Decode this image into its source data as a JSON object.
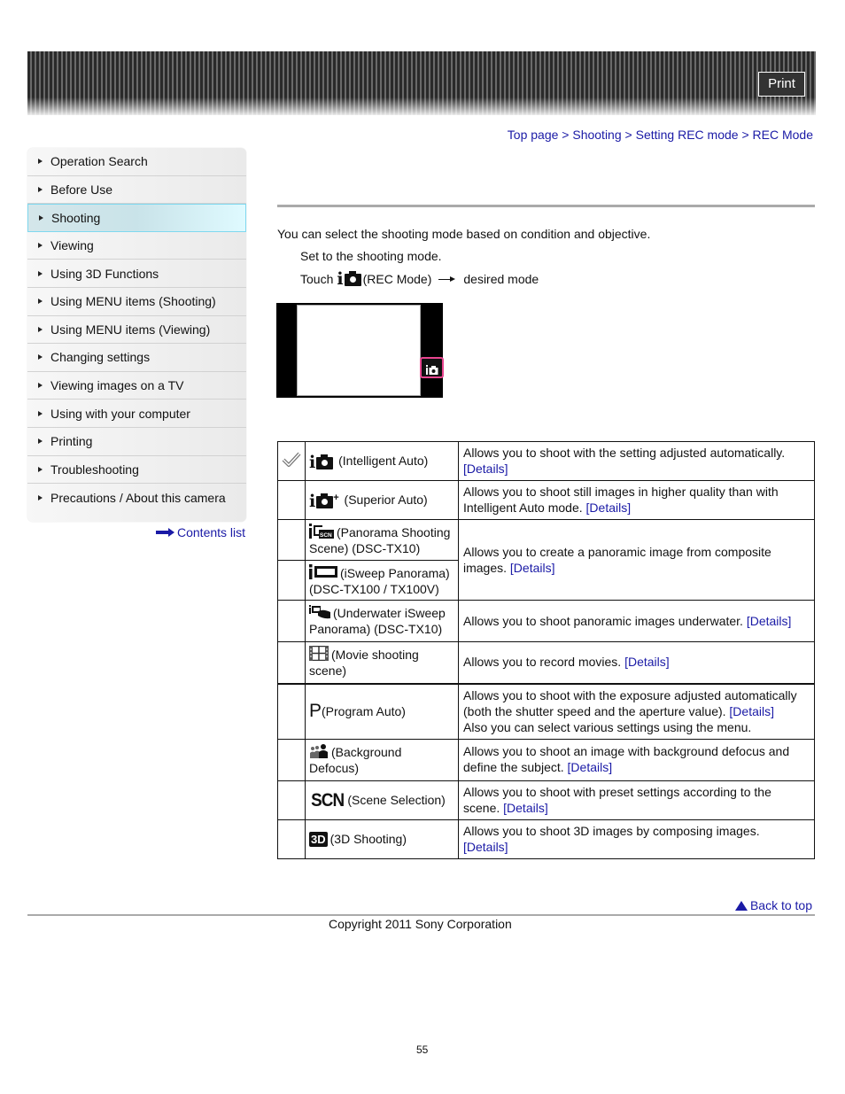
{
  "header": {
    "print_label": "Print"
  },
  "breadcrumb": [
    {
      "label": "Top page"
    },
    {
      "label": "Shooting"
    },
    {
      "label": "Setting REC mode"
    },
    {
      "label": "REC Mode"
    }
  ],
  "breadcrumb_separator": ">",
  "sidebar": {
    "items": [
      {
        "label": "Operation Search",
        "active": false
      },
      {
        "label": "Before Use",
        "active": false
      },
      {
        "label": "Shooting",
        "active": true
      },
      {
        "label": "Viewing",
        "active": false
      },
      {
        "label": "Using 3D Functions",
        "active": false
      },
      {
        "label": "Using MENU items (Shooting)",
        "active": false
      },
      {
        "label": "Using MENU items (Viewing)",
        "active": false
      },
      {
        "label": "Changing settings",
        "active": false
      },
      {
        "label": "Viewing images on a TV",
        "active": false
      },
      {
        "label": "Using with your computer",
        "active": false
      },
      {
        "label": "Printing",
        "active": false
      },
      {
        "label": "Troubleshooting",
        "active": false
      },
      {
        "label": "Precautions / About this camera",
        "active": false
      }
    ],
    "contents_list_label": "Contents list"
  },
  "main": {
    "intro": "You can select the shooting mode based on condition and objective.",
    "step1": "Set to the shooting mode.",
    "step2": {
      "prefix": "Touch",
      "icon": "intelligent-auto-icon",
      "middle": "(REC Mode)",
      "suffix": "desired mode"
    },
    "modes": [
      {
        "icon": "intelligent-auto-icon",
        "name": "(Intelligent Auto)",
        "desc": "Allows you to shoot with the setting adjusted automatically.",
        "link": "[Details]",
        "default": true
      },
      {
        "icon": "superior-auto-icon",
        "name": "(Superior Auto)",
        "desc": "Allows you to shoot still images in higher quality than with Intelligent Auto mode.",
        "link": "[Details]"
      },
      {
        "icon": "panorama-scene-icon",
        "name": "(Panorama Shooting Scene) (DSC-TX10)",
        "desc": "Allows you to create a panoramic image from composite images.",
        "link": "[Details]"
      },
      {
        "icon": "isweep-panorama-icon",
        "name": "(iSweep Panorama) (DSC-TX100 / TX100V)"
      },
      {
        "icon": "underwater-panorama-icon",
        "name": "(Underwater iSweep Panorama) (DSC-TX10)",
        "desc": "Allows you to shoot panoramic images underwater.",
        "link": "[Details]"
      },
      {
        "icon": "movie-icon",
        "name": "(Movie shooting scene)",
        "desc": "Allows you to record movies.",
        "link": "[Details]"
      },
      {
        "icon": "program-auto-icon",
        "name": "(Program Auto)",
        "desc": "Allows you to shoot with the exposure adjusted automatically (both the shutter speed and the aperture value).",
        "link": "[Details]",
        "desc2": "Also you can select various settings using the menu."
      },
      {
        "icon": "background-defocus-icon",
        "name": "(Background Defocus)",
        "desc": "Allows you to shoot an image with background defocus and define the subject.",
        "link": "[Details]"
      },
      {
        "icon": "scene-selection-icon",
        "name": "(Scene Selection)",
        "desc": "Allows you to shoot with preset settings according to the scene.",
        "link": "[Details]"
      },
      {
        "icon": "3d-shooting-icon",
        "name": "(3D Shooting)",
        "desc": "Allows you to shoot 3D images by composing images.",
        "link": "[Details]"
      }
    ],
    "icon_text": {
      "scn": "SCN",
      "p": "P",
      "d3": "3D"
    }
  },
  "footer": {
    "back_to_top": "Back to top",
    "copyright": "Copyright 2011 Sony Corporation",
    "page_number": "55"
  }
}
